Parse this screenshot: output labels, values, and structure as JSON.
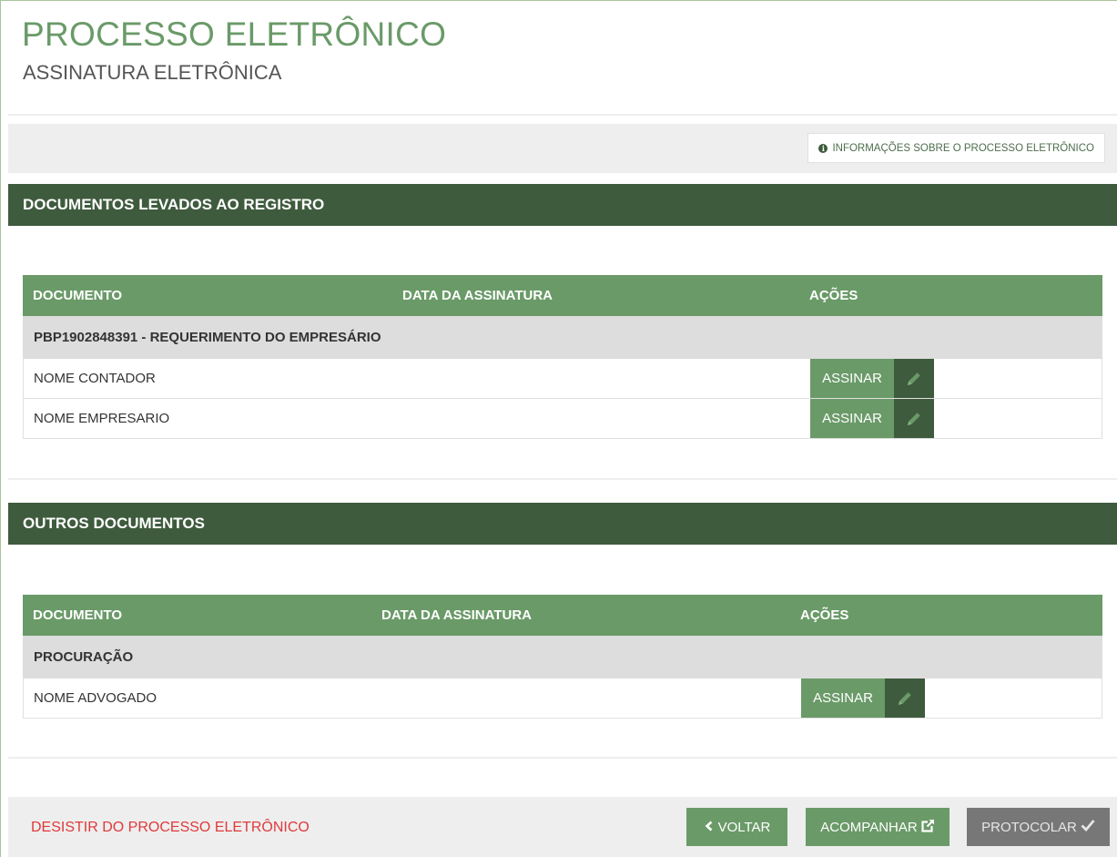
{
  "header": {
    "title": "PROCESSO ELETRÔNICO",
    "subtitle": "ASSINATURA ELETRÔNICA"
  },
  "info_button": {
    "label": "INFORMAÇÕES SOBRE O PROCESSO ELETRÔNICO",
    "icon": "info-circle-icon"
  },
  "sections": [
    {
      "title": "DOCUMENTOS LEVADOS AO REGISTRO",
      "columns": [
        "DOCUMENTO",
        "DATA DA ASSINATURA",
        "AÇÕES"
      ],
      "group": "PBP1902848391 - REQUERIMENTO DO EMPRESÁRIO",
      "rows": [
        {
          "name": "NOME CONTADOR",
          "date": "",
          "action": "ASSINAR"
        },
        {
          "name": "NOME EMPRESARIO",
          "date": "",
          "action": "ASSINAR"
        }
      ]
    },
    {
      "title": "OUTROS DOCUMENTOS",
      "columns": [
        "DOCUMENTO",
        "DATA DA ASSINATURA",
        "AÇÕES"
      ],
      "group": "PROCURAÇÃO",
      "rows": [
        {
          "name": "NOME ADVOGADO",
          "date": "",
          "action": "ASSINAR"
        }
      ]
    }
  ],
  "footer": {
    "desistir": "DESISTIR DO PROCESSO ELETRÔNICO",
    "voltar": "VOLTAR",
    "acompanhar": "ACOMPANHAR",
    "protocolar": "PROTOCOLAR"
  },
  "colors": {
    "dark_green": "#3f5b3e",
    "green": "#6a9a68",
    "danger": "#e0393b",
    "disabled": "#777777"
  }
}
